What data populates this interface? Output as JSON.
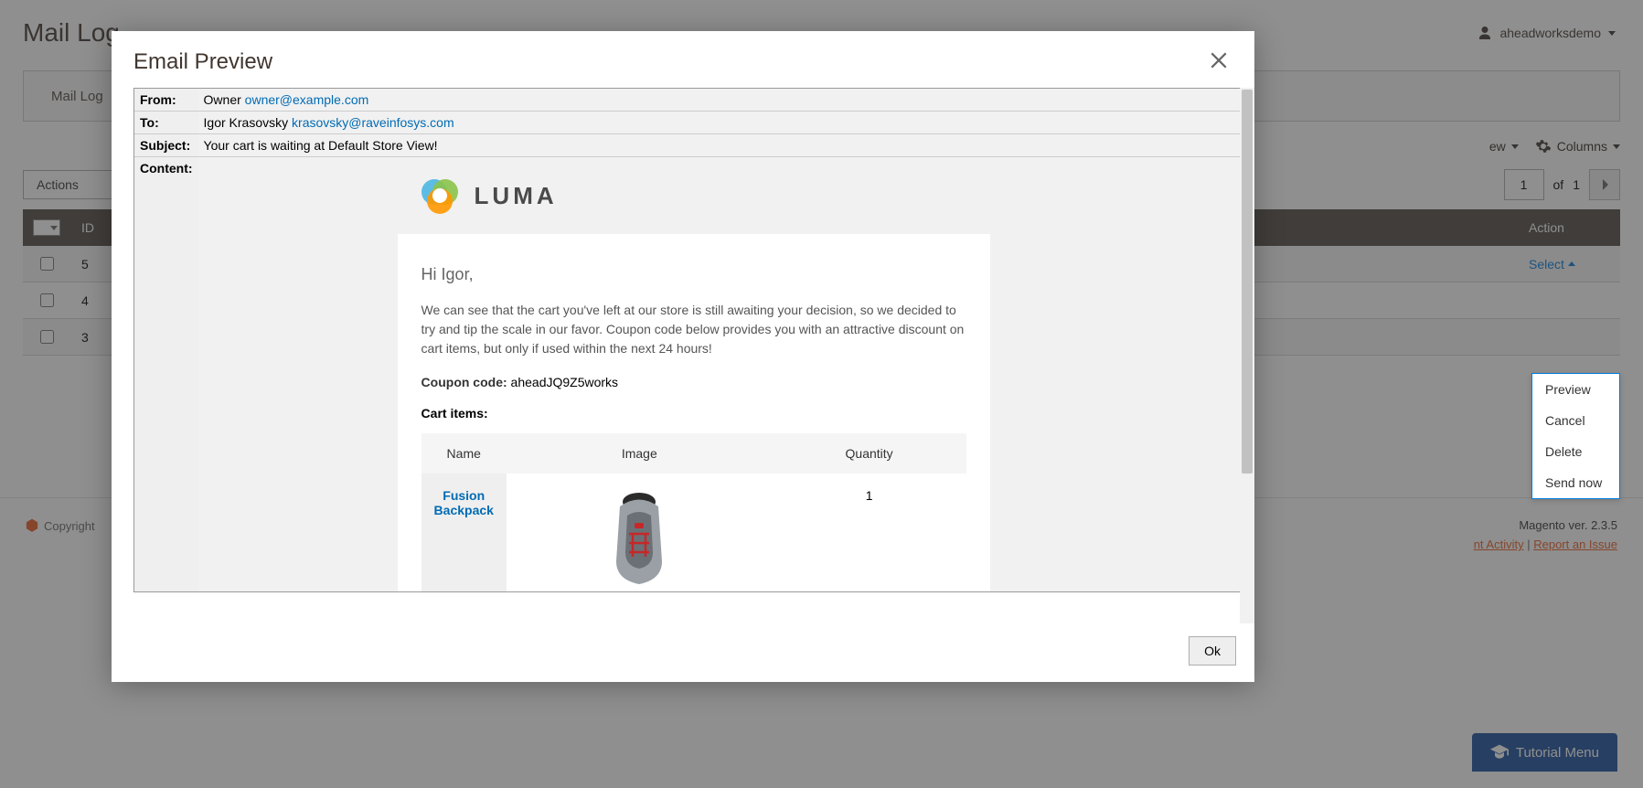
{
  "page": {
    "title": "Mail Log",
    "user": "aheadworksdemo",
    "tab_label": "Mail Log",
    "toolbar": {
      "view_label": "ew",
      "columns_label": "Columns"
    },
    "actions_label": "Actions",
    "pager": {
      "page": "1",
      "of_label": "of",
      "total": "1"
    },
    "columns": {
      "id": "ID",
      "action": "Action"
    },
    "rows": [
      {
        "id": "5",
        "action": "Select"
      },
      {
        "id": "4"
      },
      {
        "id": "3"
      }
    ],
    "dropdown": [
      "Preview",
      "Cancel",
      "Delete",
      "Send now"
    ],
    "footer": {
      "copyright": "Copyright",
      "version": "Magento ver. 2.3.5",
      "activity": "nt Activity",
      "issue": "Report an Issue"
    },
    "tutorial": "Tutorial Menu"
  },
  "modal": {
    "title": "Email Preview",
    "ok": "Ok",
    "meta": {
      "from_label": "From:",
      "from_name": "Owner",
      "from_email": "owner@example.com",
      "to_label": "To:",
      "to_name": "Igor Krasovsky",
      "to_email": "krasovsky@raveinfosys.com",
      "subject_label": "Subject:",
      "subject": "Your cart is waiting at Default Store View!",
      "content_label": "Content:"
    },
    "email": {
      "brand": "LUMA",
      "greeting": "Hi Igor,",
      "body": "We can see that the cart you've left at our store is still awaiting your decision, so we decided to try and tip the scale in our favor. Coupon code below provides you with an attractive discount on cart items, but only if used within the next 24 hours!",
      "coupon_label": "Coupon code:",
      "coupon_code": "aheadJQ9Z5works",
      "cart_label": "Cart items:",
      "cart_headers": {
        "name": "Name",
        "image": "Image",
        "qty": "Quantity"
      },
      "cart_items": [
        {
          "name": "Fusion Backpack",
          "qty": "1"
        }
      ]
    }
  }
}
